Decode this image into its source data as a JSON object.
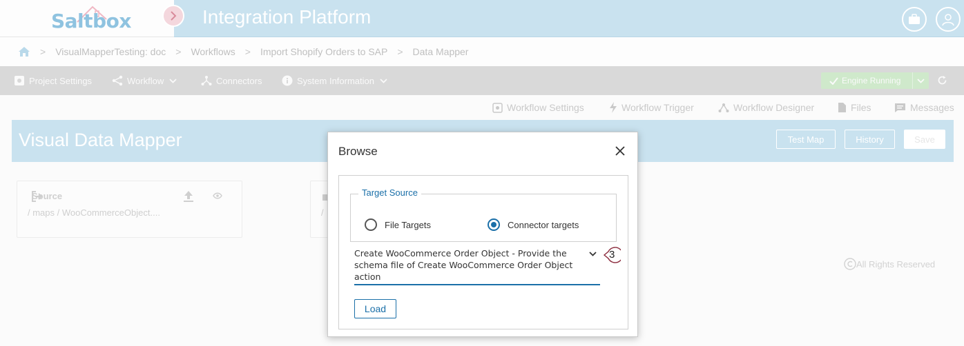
{
  "header": {
    "logo_text": "Saltbox",
    "app_title": "Integration Platform"
  },
  "breadcrumb": {
    "items": [
      "VisualMapperTesting: doc",
      "Workflows",
      "Import Shopify Orders to SAP",
      "Data Mapper"
    ]
  },
  "nav": {
    "project_settings": "Project Settings",
    "workflow": "Workflow",
    "connectors": "Connectors",
    "system_information": "System Information",
    "engine_status": "Engine Running"
  },
  "subtoolbar": {
    "workflow_settings": "Workflow Settings",
    "workflow_trigger": "Workflow Trigger",
    "workflow_designer": "Workflow Designer",
    "files": "Files",
    "messages": "Messages"
  },
  "page": {
    "title": "Visual Data Mapper",
    "test_map": "Test Map",
    "history": "History",
    "save": "Save"
  },
  "source_panel": {
    "title": "Source",
    "path": "/ maps / WooCommerceObject...."
  },
  "target_panel_partial": {
    "path": "/"
  },
  "footer": {
    "copyright": "All Rights Reserved"
  },
  "modal": {
    "title": "Browse",
    "legend": "Target Source",
    "option_file": "File Targets",
    "option_connector": "Connector targets",
    "selected_option": "Connector targets",
    "selected_value": "Create WooCommerce Order Object - Provide the schema file of Create WooCommerce Order Object action",
    "badge": "3",
    "load": "Load"
  },
  "colors": {
    "accent": "#1a6fa8",
    "header_bg": "#c9e2ef",
    "engine_bg": "#cfe9cb",
    "badge_border": "#8b2a3c"
  }
}
